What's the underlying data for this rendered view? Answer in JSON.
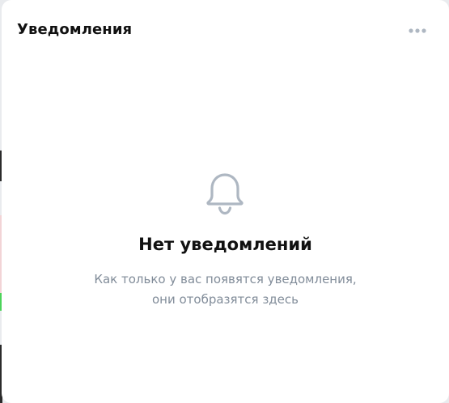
{
  "panel": {
    "title": "Уведомления",
    "more_icon": "more-horizontal-icon"
  },
  "empty_state": {
    "icon": "bell-icon",
    "title": "Нет уведомлений",
    "description_line1": "Как только у вас появятся уведомления,",
    "description_line2": "они отобразятся здесь"
  },
  "colors": {
    "background": "#e9ebee",
    "panel": "#ffffff",
    "title_text": "#111111",
    "secondary_text": "#818c99",
    "icon": "#aeb7c2"
  }
}
